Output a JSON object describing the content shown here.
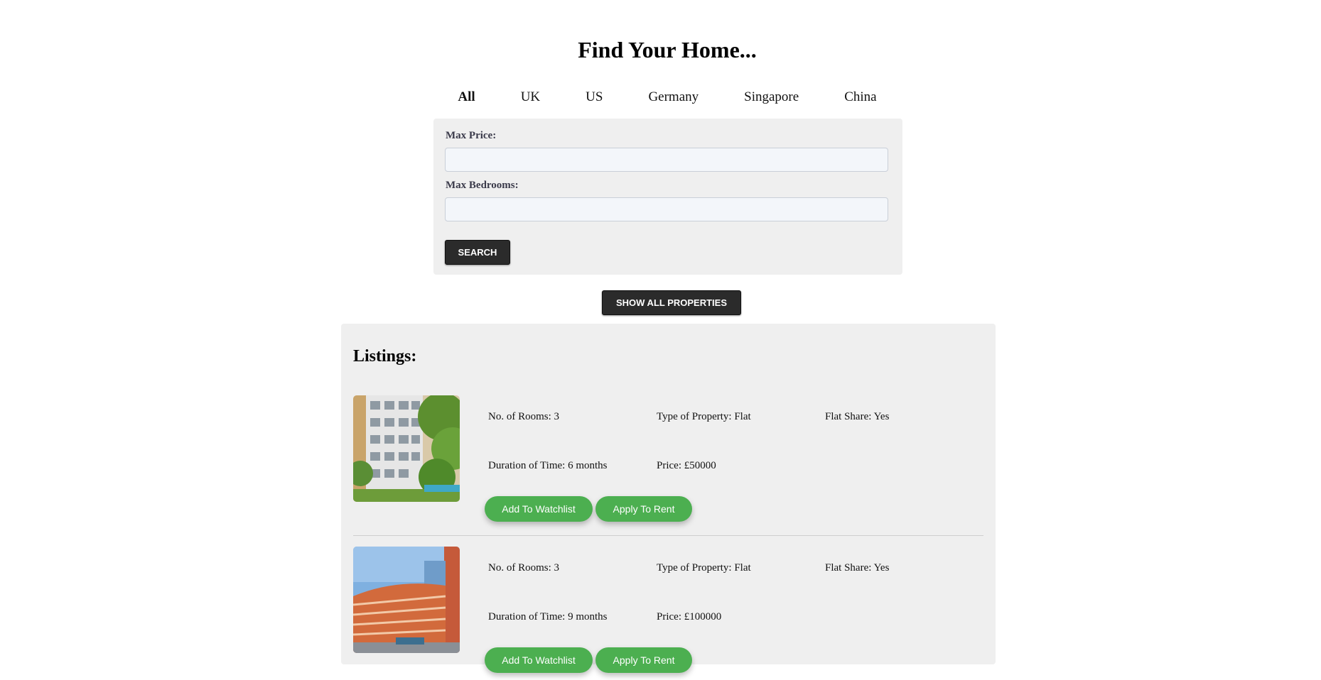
{
  "header": {
    "title": "Find Your Home..."
  },
  "tabs": [
    {
      "label": "All",
      "active": true
    },
    {
      "label": "UK",
      "active": false
    },
    {
      "label": "US",
      "active": false
    },
    {
      "label": "Germany",
      "active": false
    },
    {
      "label": "Singapore",
      "active": false
    },
    {
      "label": "China",
      "active": false
    }
  ],
  "filters": {
    "max_price_label": "Max Price:",
    "max_price_value": "",
    "max_bedrooms_label": "Max Bedrooms:",
    "max_bedrooms_value": "",
    "search_label": "SEARCH"
  },
  "show_all_label": "SHOW ALL PROPERTIES",
  "listings": {
    "title": "Listings:",
    "items": [
      {
        "rooms": "No. of Rooms: 3",
        "type": "Type of Property: Flat",
        "flatshare": "Flat Share: Yes",
        "duration": "Duration of Time: 6 months",
        "price": "Price: £50000",
        "watchlist_label": "Add To Watchlist",
        "rent_label": "Apply To Rent"
      },
      {
        "rooms": "No. of Rooms: 3",
        "type": "Type of Property: Flat",
        "flatshare": "Flat Share: Yes",
        "duration": "Duration of Time: 9 months",
        "price": "Price: £100000",
        "watchlist_label": "Add To Watchlist",
        "rent_label": "Apply To Rent"
      }
    ]
  },
  "colors": {
    "accent_green": "#4caf50",
    "dark_button": "#2b2b2b",
    "panel_bg": "#efefef"
  }
}
